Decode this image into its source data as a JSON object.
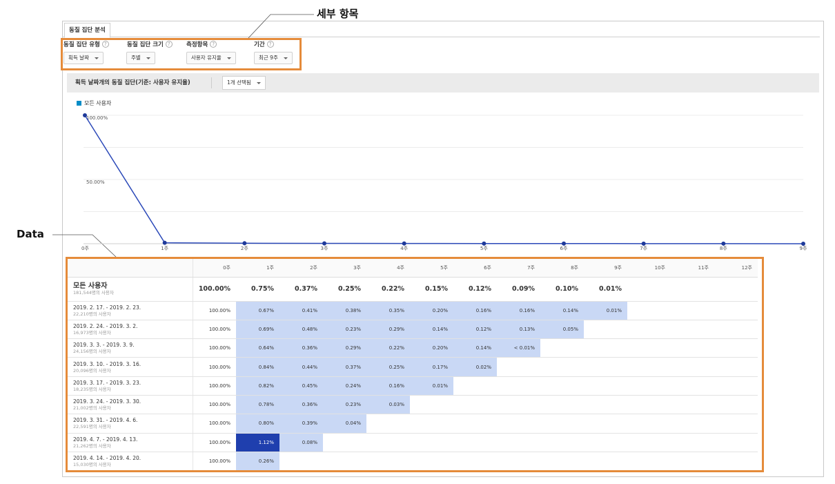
{
  "tab": {
    "label": "동질 집단 분석"
  },
  "filters": [
    {
      "label": "동질 집단 유형",
      "value": "획득 날짜"
    },
    {
      "label": "동질 집단 크기",
      "value": "주별"
    },
    {
      "label": "측정항목",
      "value": "사용자 유지율"
    },
    {
      "label": "기간",
      "value": "최근 9주"
    }
  ],
  "annotations": {
    "top": "세부 항목",
    "data": "Data"
  },
  "chartbar": {
    "title": "획득 날짜개의 동질 집단(기준: 사용자 유지율)",
    "select": "1개 선택됨"
  },
  "chart_data": {
    "type": "line",
    "legend": "모든 사용자",
    "x": [
      "0주",
      "1주",
      "2주",
      "3주",
      "4주",
      "5주",
      "6주",
      "7주",
      "8주",
      "9주"
    ],
    "series": [
      {
        "name": "모든 사용자",
        "values": [
          100.0,
          0.75,
          0.37,
          0.25,
          0.22,
          0.15,
          0.12,
          0.09,
          0.1,
          0.01
        ]
      }
    ],
    "yticks": [
      "100.00%",
      "50.00%"
    ],
    "ylim": [
      0,
      100
    ],
    "color": "#2a48b8"
  },
  "table": {
    "columns": [
      "0주",
      "1주",
      "2주",
      "3주",
      "4주",
      "5주",
      "6주",
      "7주",
      "8주",
      "9주",
      "10주",
      "11주",
      "12주"
    ],
    "total": {
      "label": "모든 사용자",
      "sub": "181,544명의 사용자",
      "values": [
        "100.00%",
        "0.75%",
        "0.37%",
        "0.25%",
        "0.22%",
        "0.15%",
        "0.12%",
        "0.09%",
        "0.10%",
        "0.01%"
      ]
    },
    "rows": [
      {
        "label": "2019. 2. 17. - 2019. 2. 23.",
        "sub": "22,210명의 사용자",
        "values": [
          "100.00%",
          "0.67%",
          "0.41%",
          "0.38%",
          "0.35%",
          "0.20%",
          "0.16%",
          "0.16%",
          "0.14%",
          "0.01%"
        ]
      },
      {
        "label": "2019. 2. 24. - 2019. 3. 2.",
        "sub": "16,973명의 사용자",
        "values": [
          "100.00%",
          "0.69%",
          "0.48%",
          "0.23%",
          "0.29%",
          "0.14%",
          "0.12%",
          "0.13%",
          "0.05%"
        ]
      },
      {
        "label": "2019. 3. 3. - 2019. 3. 9.",
        "sub": "24,156명의 사용자",
        "values": [
          "100.00%",
          "0.64%",
          "0.36%",
          "0.29%",
          "0.22%",
          "0.20%",
          "0.14%",
          "< 0.01%"
        ]
      },
      {
        "label": "2019. 3. 10. - 2019. 3. 16.",
        "sub": "20,096명의 사용자",
        "values": [
          "100.00%",
          "0.84%",
          "0.44%",
          "0.37%",
          "0.25%",
          "0.17%",
          "0.02%"
        ]
      },
      {
        "label": "2019. 3. 17. - 2019. 3. 23.",
        "sub": "18,235명의 사용자",
        "values": [
          "100.00%",
          "0.82%",
          "0.45%",
          "0.24%",
          "0.16%",
          "0.01%"
        ]
      },
      {
        "label": "2019. 3. 24. - 2019. 3. 30.",
        "sub": "21,002명의 사용자",
        "values": [
          "100.00%",
          "0.78%",
          "0.36%",
          "0.23%",
          "0.03%"
        ]
      },
      {
        "label": "2019. 3. 31. - 2019. 4. 6.",
        "sub": "22,591명의 사용자",
        "values": [
          "100.00%",
          "0.80%",
          "0.39%",
          "0.04%"
        ]
      },
      {
        "label": "2019. 4. 7. - 2019. 4. 13.",
        "sub": "21,262명의 사용자",
        "values": [
          "100.00%",
          "1.12%",
          "0.08%"
        ]
      },
      {
        "label": "2019. 4. 14. - 2019. 4. 20.",
        "sub": "15,030명의 사용자",
        "values": [
          "100.00%",
          "0.26%"
        ]
      }
    ],
    "highlight": "1.12%"
  },
  "colors": {
    "accent_orange": "#e58b3a",
    "cell_low": "#c9d8f5",
    "cell_high": "#1f3fae",
    "line": "#2a48b8"
  }
}
